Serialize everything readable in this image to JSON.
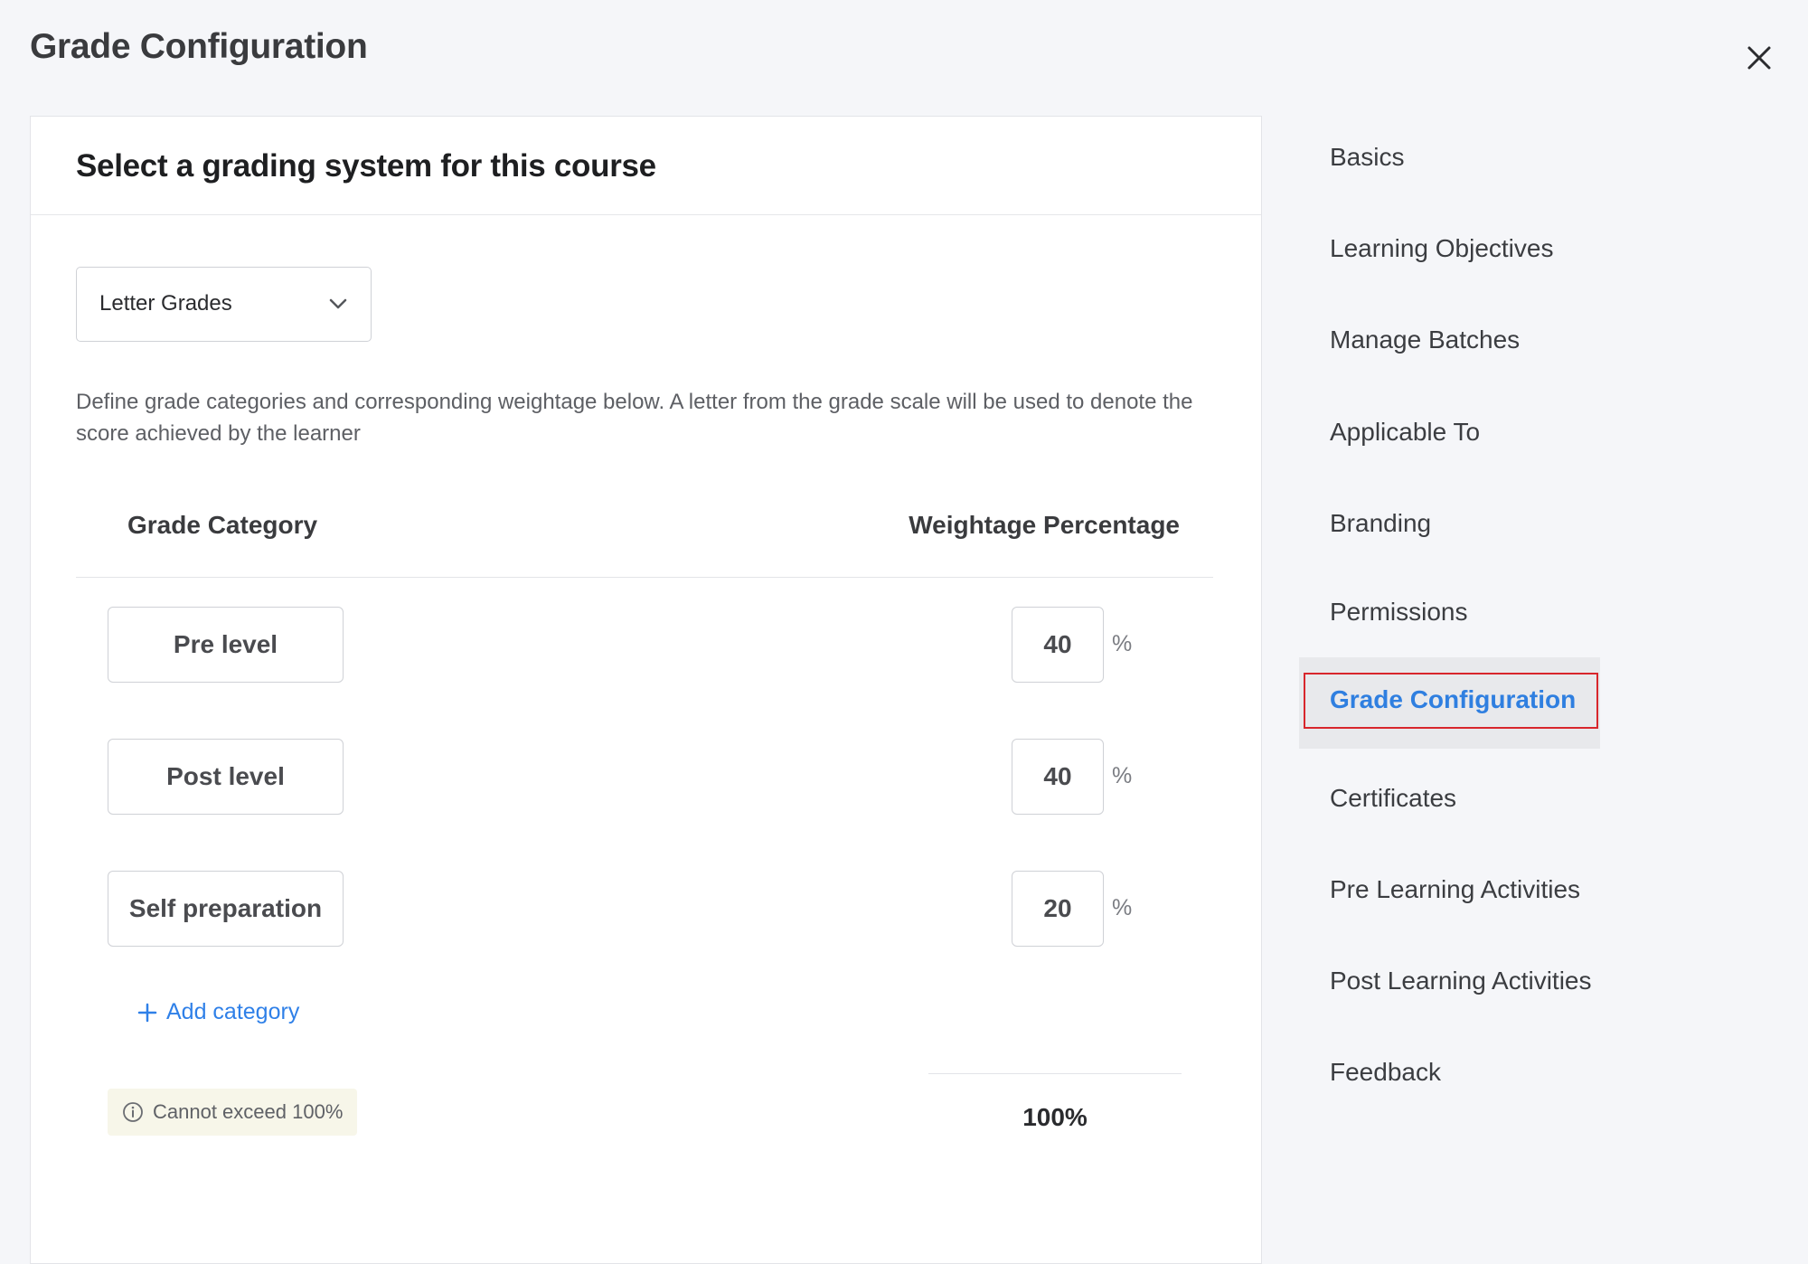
{
  "page": {
    "title": "Grade Configuration",
    "close_icon": "close-icon"
  },
  "card": {
    "title": "Select a grading system for this course",
    "grading_system": {
      "selected": "Letter Grades",
      "icon": "chevron-down-icon"
    },
    "description": "Define grade categories and corresponding weightage below. A letter from the grade scale will be used to denote the score achieved by the learner",
    "table": {
      "headers": {
        "category": "Grade Category",
        "weightage": "Weightage Percentage"
      },
      "rows": [
        {
          "category": "Pre level",
          "weight": "40",
          "unit": "%"
        },
        {
          "category": "Post level",
          "weight": "40",
          "unit": "%"
        },
        {
          "category": "Self preparation",
          "weight": "20",
          "unit": "%"
        }
      ]
    },
    "add_category_label": "Add category",
    "warning_text": "Cannot exceed 100%",
    "total": "100%"
  },
  "side_nav": {
    "items": [
      {
        "label": "Basics"
      },
      {
        "label": "Learning Objectives"
      },
      {
        "label": "Manage Batches"
      },
      {
        "label": "Applicable To"
      },
      {
        "label": "Branding"
      },
      {
        "label": "Permissions"
      },
      {
        "label": "Grade Configuration",
        "active": true
      },
      {
        "label": "Certificates"
      },
      {
        "label": "Pre Learning Activities"
      },
      {
        "label": "Post Learning Activities"
      },
      {
        "label": "Feedback"
      }
    ]
  },
  "colors": {
    "accent": "#2f7fe0",
    "highlight_outline": "#d8262c",
    "warning_bg": "#f7f6e9",
    "page_bg": "#f5f6f9"
  }
}
